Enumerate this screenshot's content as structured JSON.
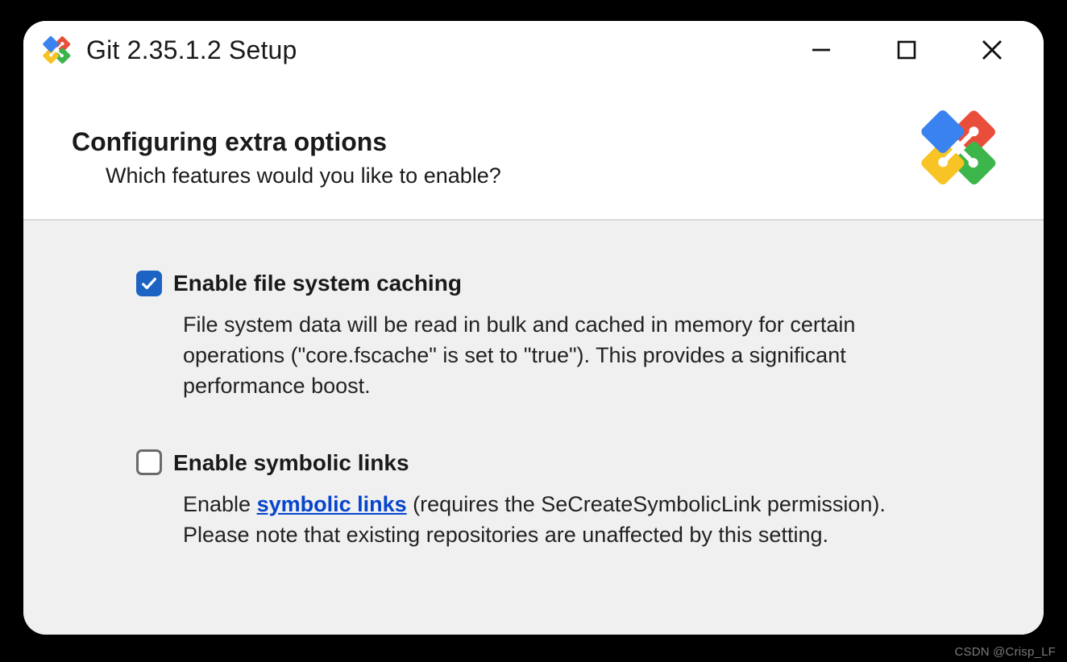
{
  "window": {
    "title": "Git 2.35.1.2 Setup"
  },
  "header": {
    "title": "Configuring extra options",
    "subtitle": "Which features would you like to enable?"
  },
  "options": {
    "fscache": {
      "checked": true,
      "label": "Enable file system caching",
      "description": "File system data will be read in bulk and cached in memory for certain operations (\"core.fscache\" is set to \"true\"). This provides a significant performance boost."
    },
    "symlinks": {
      "checked": false,
      "label": "Enable symbolic links",
      "desc_pre": "Enable ",
      "link_text": "symbolic links",
      "desc_post": " (requires the SeCreateSymbolicLink permission). Please note that existing repositories are unaffected by this setting."
    }
  },
  "watermark": "CSDN @Crisp_LF"
}
